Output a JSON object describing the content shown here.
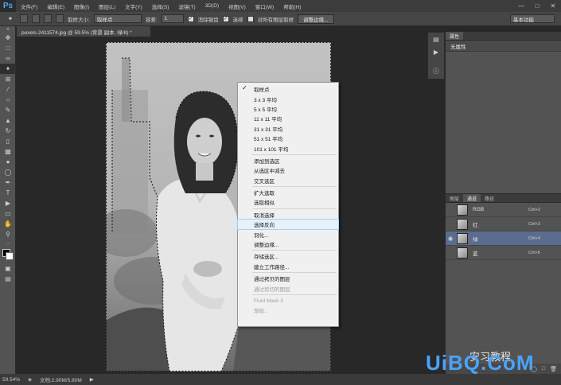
{
  "menubar": {
    "logo": "Ps",
    "items": [
      "文件(F)",
      "编辑(E)",
      "图像(I)",
      "图层(L)",
      "文字(Y)",
      "选择(S)",
      "滤镜(T)",
      "3D(D)",
      "视图(V)",
      "窗口(W)",
      "帮助(H)"
    ]
  },
  "optionsbar": {
    "sample_size_label": "取样大小:",
    "sample_size_value": "取样点",
    "tolerance_label": "容差:",
    "tolerance_value": "1",
    "anti_alias_label": "消除锯齿",
    "contiguous_label": "连续",
    "all_layers_label": "对所有图层取样",
    "refine_edge_button": "调整边缘...",
    "workspace_value": "基本功能"
  },
  "document": {
    "tab_title": "pexels-2411574.jpg @ 59.5% (背景 副本, 绿/8) *"
  },
  "context_menu": {
    "items": [
      {
        "label": "取样点",
        "checked": true
      },
      {
        "label": "3 x 3 平均"
      },
      {
        "label": "5 x 5 平均"
      },
      {
        "label": "11 x 11 平均"
      },
      {
        "label": "31 x 31 平均"
      },
      {
        "label": "51 x 51 平均"
      },
      {
        "label": "101 x 101 平均"
      },
      {
        "sep": true
      },
      {
        "label": "添加到选区"
      },
      {
        "label": "从选区中减去"
      },
      {
        "label": "交叉选区"
      },
      {
        "sep": true
      },
      {
        "label": "扩大选取"
      },
      {
        "label": "选取相似"
      },
      {
        "sep": true
      },
      {
        "label": "取消选择"
      },
      {
        "label": "选择反向",
        "highlighted": true
      },
      {
        "label": "羽化..."
      },
      {
        "label": "调整边缘..."
      },
      {
        "sep": true
      },
      {
        "label": "存储选区..."
      },
      {
        "label": "建立工作路径..."
      },
      {
        "sep": true
      },
      {
        "label": "通过拷贝的图层"
      },
      {
        "label": "通过剪切的图层",
        "disabled": true
      },
      {
        "sep": true
      },
      {
        "label": "Fluid Mask 3",
        "disabled": true
      },
      {
        "label": "渐隐...",
        "disabled": true
      }
    ]
  },
  "properties_panel": {
    "tab": "属性",
    "body_text": "无属性"
  },
  "channels_panel": {
    "tabs": [
      "图层",
      "通道",
      "路径"
    ],
    "channels": [
      {
        "name": "RGB",
        "shortcut": "Ctrl+2"
      },
      {
        "name": "红",
        "shortcut": "Ctrl+3"
      },
      {
        "name": "绿",
        "shortcut": "Ctrl+4",
        "selected": true
      },
      {
        "name": "蓝",
        "shortcut": "Ctrl+5"
      }
    ]
  },
  "statusbar": {
    "zoom": "59.54%",
    "doc_info": "文档:2.90M/5.80M"
  },
  "watermark": {
    "text": "UiBQ.CoM",
    "sub": "安习教程"
  }
}
